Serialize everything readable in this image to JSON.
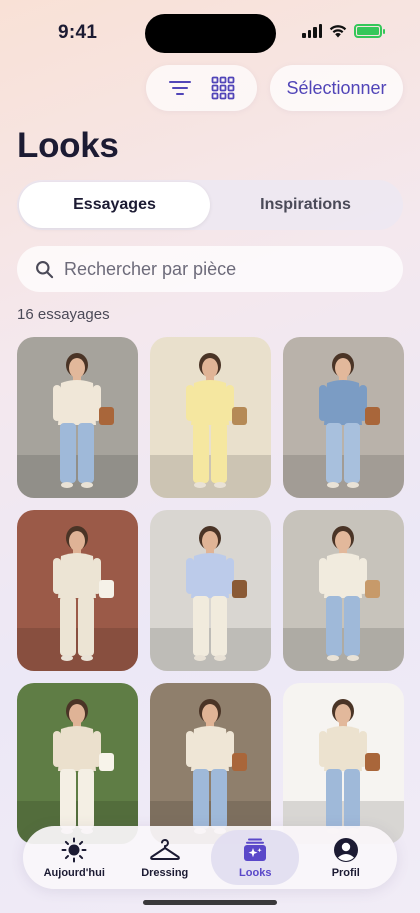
{
  "status_bar": {
    "time": "9:41"
  },
  "toolbar": {
    "filter_icon": "filter-lines-icon",
    "grid_icon": "grid-icon",
    "select_label": "Sélectionner"
  },
  "page": {
    "title": "Looks"
  },
  "segments": [
    {
      "label": "Essayages",
      "active": true
    },
    {
      "label": "Inspirations",
      "active": false
    }
  ],
  "search": {
    "placeholder": "Rechercher par pièce",
    "value": ""
  },
  "results": {
    "count_label": "16 essayages"
  },
  "looks": [
    {
      "bg": "#a6a39c",
      "skin": "#e2b89b",
      "top": "#f0e7d8",
      "bottom": "#9fb9d9",
      "accent": "#a9663a"
    },
    {
      "bg": "#e9e0cc",
      "skin": "#e0b496",
      "top": "#f5e7a0",
      "bottom": "#f5e7a0",
      "accent": "#b58a56"
    },
    {
      "bg": "#b9b2aa",
      "skin": "#e2b89b",
      "top": "#7b9cc4",
      "bottom": "#a8c0dd",
      "accent": "#a9663a"
    },
    {
      "bg": "#9b5a48",
      "skin": "#dfb396",
      "top": "#ece4d4",
      "bottom": "#ece4d4",
      "accent": "#f5f1e8"
    },
    {
      "bg": "#d9d6d1",
      "skin": "#e0b496",
      "top": "#bccbea",
      "bottom": "#f1ebdd",
      "accent": "#8a5a36"
    },
    {
      "bg": "#c7c3bb",
      "skin": "#e2b89b",
      "top": "#f1ebde",
      "bottom": "#9fb9d9",
      "accent": "#c79a6a"
    },
    {
      "bg": "#5f7d45",
      "skin": "#dfb396",
      "top": "#ebe0cd",
      "bottom": "#f4efe4",
      "accent": "#f7f3ea"
    },
    {
      "bg": "#8f7f6c",
      "skin": "#e0b496",
      "top": "#efe6d6",
      "bottom": "#9fb9d9",
      "accent": "#a9663a"
    },
    {
      "bg": "#f6f4f1",
      "skin": "#e2b89b",
      "top": "#ece2cf",
      "bottom": "#9fb9d9",
      "accent": "#a9663a"
    }
  ],
  "tabs": [
    {
      "label": "Aujourd'hui",
      "icon": "sun-icon",
      "active": false
    },
    {
      "label": "Dressing",
      "icon": "hanger-icon",
      "active": false
    },
    {
      "label": "Looks",
      "icon": "sparkle-stack-icon",
      "active": true
    },
    {
      "label": "Profil",
      "icon": "person-circle-icon",
      "active": false
    }
  ],
  "colors": {
    "accent": "#5a48c9",
    "battery": "#35c759"
  }
}
